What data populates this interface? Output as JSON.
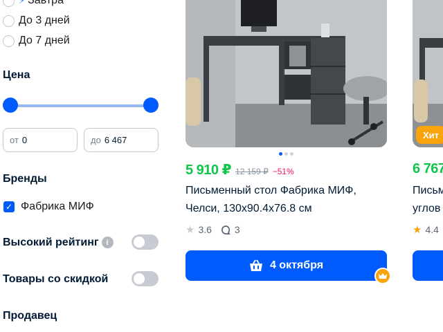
{
  "filters": {
    "delivery_options": [
      {
        "label": "Завтра",
        "icon": "lightning-icon"
      },
      {
        "label": "До 3 дней"
      },
      {
        "label": "До 7 дней"
      }
    ],
    "price": {
      "title": "Цена",
      "from_prefix": "от",
      "from_value": "0",
      "to_prefix": "до",
      "to_value": "6 467"
    },
    "brands": {
      "title": "Бренды",
      "items": [
        {
          "label": "Фабрика МИФ",
          "checked": true
        }
      ]
    },
    "toggles": [
      {
        "label": "Высокий рейтинг",
        "enabled": false,
        "has_info": true
      },
      {
        "label": "Товары со скидкой",
        "enabled": false
      }
    ],
    "seller": {
      "title": "Продавец"
    }
  },
  "products": [
    {
      "price": "5 910 ₽",
      "old_price": "12 159 ₽",
      "discount": "−51%",
      "title": "Письменный стол Фабрика МИФ, Челси, 130х90.4х76.8 см",
      "rating": "3.6",
      "reviews": "3",
      "delivery": "4 октября",
      "image_pages": 3,
      "active_image": 0
    },
    {
      "badge": "Хит",
      "price": "6 767",
      "title": "Письм",
      "title_line2": "углов",
      "rating": "4.4"
    }
  ],
  "colors": {
    "accent": "#005bff",
    "price_green": "#10c44c",
    "discount_red": "#f91155",
    "badge_orange": "#f9a40d"
  }
}
